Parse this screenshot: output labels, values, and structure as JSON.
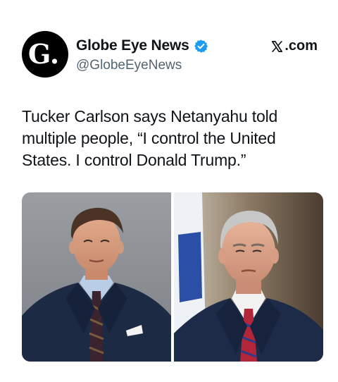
{
  "account": {
    "avatar_letter": "G.",
    "display_name": "Globe Eye News",
    "verified_icon": "verified-badge-icon",
    "handle": "@GlobeEyeNews",
    "source": "𝕏.com",
    "source_text": ".com"
  },
  "tweet": {
    "text": "Tucker Carlson says Netanyahu told multiple people, “I control the United States. I control Donald Trump.”"
  },
  "media": {
    "images": [
      {
        "subject": "man-in-navy-suit-portrait",
        "background": "gray"
      },
      {
        "subject": "gray-haired-man-with-flag-portrait",
        "background": "dark"
      }
    ]
  },
  "colors": {
    "verified": "#1d9bf0",
    "text": "#0f1419",
    "secondary": "#536471"
  }
}
